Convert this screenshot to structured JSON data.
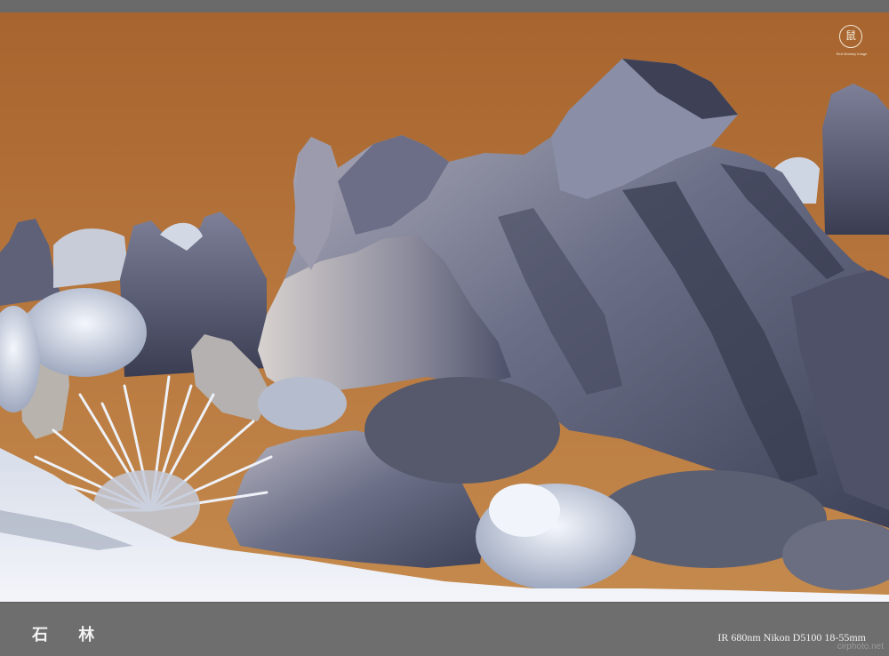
{
  "image": {
    "title": "石 林",
    "caption": "IR 680nm   Nikon D5100 18-55mm",
    "watermark": "cirphoto.net",
    "logo": {
      "glyph": "鼠",
      "text": "Red Monkey Image"
    }
  },
  "colors": {
    "sky_top": "#a8642e",
    "sky_bottom": "#c58a4d",
    "rock": "#5a5f78",
    "rock_highlight": "#c9c6d0",
    "foliage": "#dfe6f2",
    "ground": "#e9edf4",
    "frame": "#6e6e6e"
  }
}
